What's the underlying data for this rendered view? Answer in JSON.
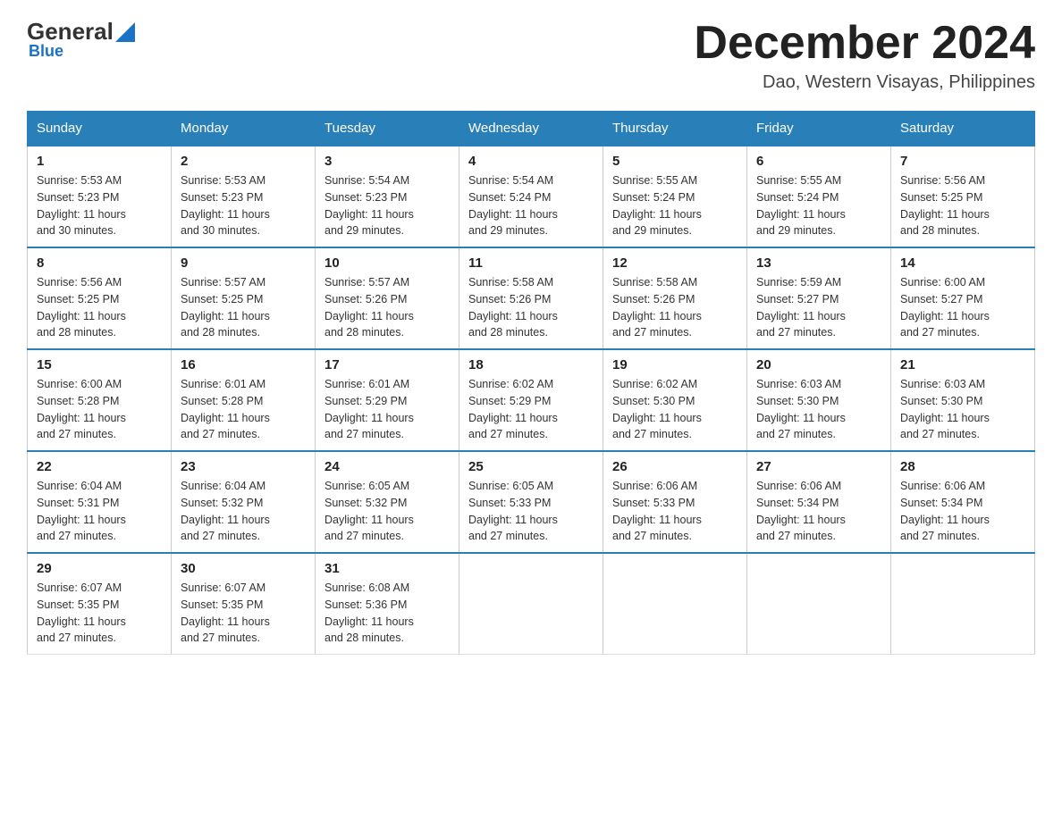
{
  "logo": {
    "general": "General",
    "blue": "Blue"
  },
  "header": {
    "title": "December 2024",
    "location": "Dao, Western Visayas, Philippines"
  },
  "weekdays": [
    "Sunday",
    "Monday",
    "Tuesday",
    "Wednesday",
    "Thursday",
    "Friday",
    "Saturday"
  ],
  "weeks": [
    [
      {
        "day": "1",
        "sunrise": "5:53 AM",
        "sunset": "5:23 PM",
        "daylight": "11 hours and 30 minutes."
      },
      {
        "day": "2",
        "sunrise": "5:53 AM",
        "sunset": "5:23 PM",
        "daylight": "11 hours and 30 minutes."
      },
      {
        "day": "3",
        "sunrise": "5:54 AM",
        "sunset": "5:23 PM",
        "daylight": "11 hours and 29 minutes."
      },
      {
        "day": "4",
        "sunrise": "5:54 AM",
        "sunset": "5:24 PM",
        "daylight": "11 hours and 29 minutes."
      },
      {
        "day": "5",
        "sunrise": "5:55 AM",
        "sunset": "5:24 PM",
        "daylight": "11 hours and 29 minutes."
      },
      {
        "day": "6",
        "sunrise": "5:55 AM",
        "sunset": "5:24 PM",
        "daylight": "11 hours and 29 minutes."
      },
      {
        "day": "7",
        "sunrise": "5:56 AM",
        "sunset": "5:25 PM",
        "daylight": "11 hours and 28 minutes."
      }
    ],
    [
      {
        "day": "8",
        "sunrise": "5:56 AM",
        "sunset": "5:25 PM",
        "daylight": "11 hours and 28 minutes."
      },
      {
        "day": "9",
        "sunrise": "5:57 AM",
        "sunset": "5:25 PM",
        "daylight": "11 hours and 28 minutes."
      },
      {
        "day": "10",
        "sunrise": "5:57 AM",
        "sunset": "5:26 PM",
        "daylight": "11 hours and 28 minutes."
      },
      {
        "day": "11",
        "sunrise": "5:58 AM",
        "sunset": "5:26 PM",
        "daylight": "11 hours and 28 minutes."
      },
      {
        "day": "12",
        "sunrise": "5:58 AM",
        "sunset": "5:26 PM",
        "daylight": "11 hours and 27 minutes."
      },
      {
        "day": "13",
        "sunrise": "5:59 AM",
        "sunset": "5:27 PM",
        "daylight": "11 hours and 27 minutes."
      },
      {
        "day": "14",
        "sunrise": "6:00 AM",
        "sunset": "5:27 PM",
        "daylight": "11 hours and 27 minutes."
      }
    ],
    [
      {
        "day": "15",
        "sunrise": "6:00 AM",
        "sunset": "5:28 PM",
        "daylight": "11 hours and 27 minutes."
      },
      {
        "day": "16",
        "sunrise": "6:01 AM",
        "sunset": "5:28 PM",
        "daylight": "11 hours and 27 minutes."
      },
      {
        "day": "17",
        "sunrise": "6:01 AM",
        "sunset": "5:29 PM",
        "daylight": "11 hours and 27 minutes."
      },
      {
        "day": "18",
        "sunrise": "6:02 AM",
        "sunset": "5:29 PM",
        "daylight": "11 hours and 27 minutes."
      },
      {
        "day": "19",
        "sunrise": "6:02 AM",
        "sunset": "5:30 PM",
        "daylight": "11 hours and 27 minutes."
      },
      {
        "day": "20",
        "sunrise": "6:03 AM",
        "sunset": "5:30 PM",
        "daylight": "11 hours and 27 minutes."
      },
      {
        "day": "21",
        "sunrise": "6:03 AM",
        "sunset": "5:30 PM",
        "daylight": "11 hours and 27 minutes."
      }
    ],
    [
      {
        "day": "22",
        "sunrise": "6:04 AM",
        "sunset": "5:31 PM",
        "daylight": "11 hours and 27 minutes."
      },
      {
        "day": "23",
        "sunrise": "6:04 AM",
        "sunset": "5:32 PM",
        "daylight": "11 hours and 27 minutes."
      },
      {
        "day": "24",
        "sunrise": "6:05 AM",
        "sunset": "5:32 PM",
        "daylight": "11 hours and 27 minutes."
      },
      {
        "day": "25",
        "sunrise": "6:05 AM",
        "sunset": "5:33 PM",
        "daylight": "11 hours and 27 minutes."
      },
      {
        "day": "26",
        "sunrise": "6:06 AM",
        "sunset": "5:33 PM",
        "daylight": "11 hours and 27 minutes."
      },
      {
        "day": "27",
        "sunrise": "6:06 AM",
        "sunset": "5:34 PM",
        "daylight": "11 hours and 27 minutes."
      },
      {
        "day": "28",
        "sunrise": "6:06 AM",
        "sunset": "5:34 PM",
        "daylight": "11 hours and 27 minutes."
      }
    ],
    [
      {
        "day": "29",
        "sunrise": "6:07 AM",
        "sunset": "5:35 PM",
        "daylight": "11 hours and 27 minutes."
      },
      {
        "day": "30",
        "sunrise": "6:07 AM",
        "sunset": "5:35 PM",
        "daylight": "11 hours and 27 minutes."
      },
      {
        "day": "31",
        "sunrise": "6:08 AM",
        "sunset": "5:36 PM",
        "daylight": "11 hours and 28 minutes."
      },
      null,
      null,
      null,
      null
    ]
  ],
  "labels": {
    "sunrise": "Sunrise:",
    "sunset": "Sunset:",
    "daylight": "Daylight:"
  }
}
